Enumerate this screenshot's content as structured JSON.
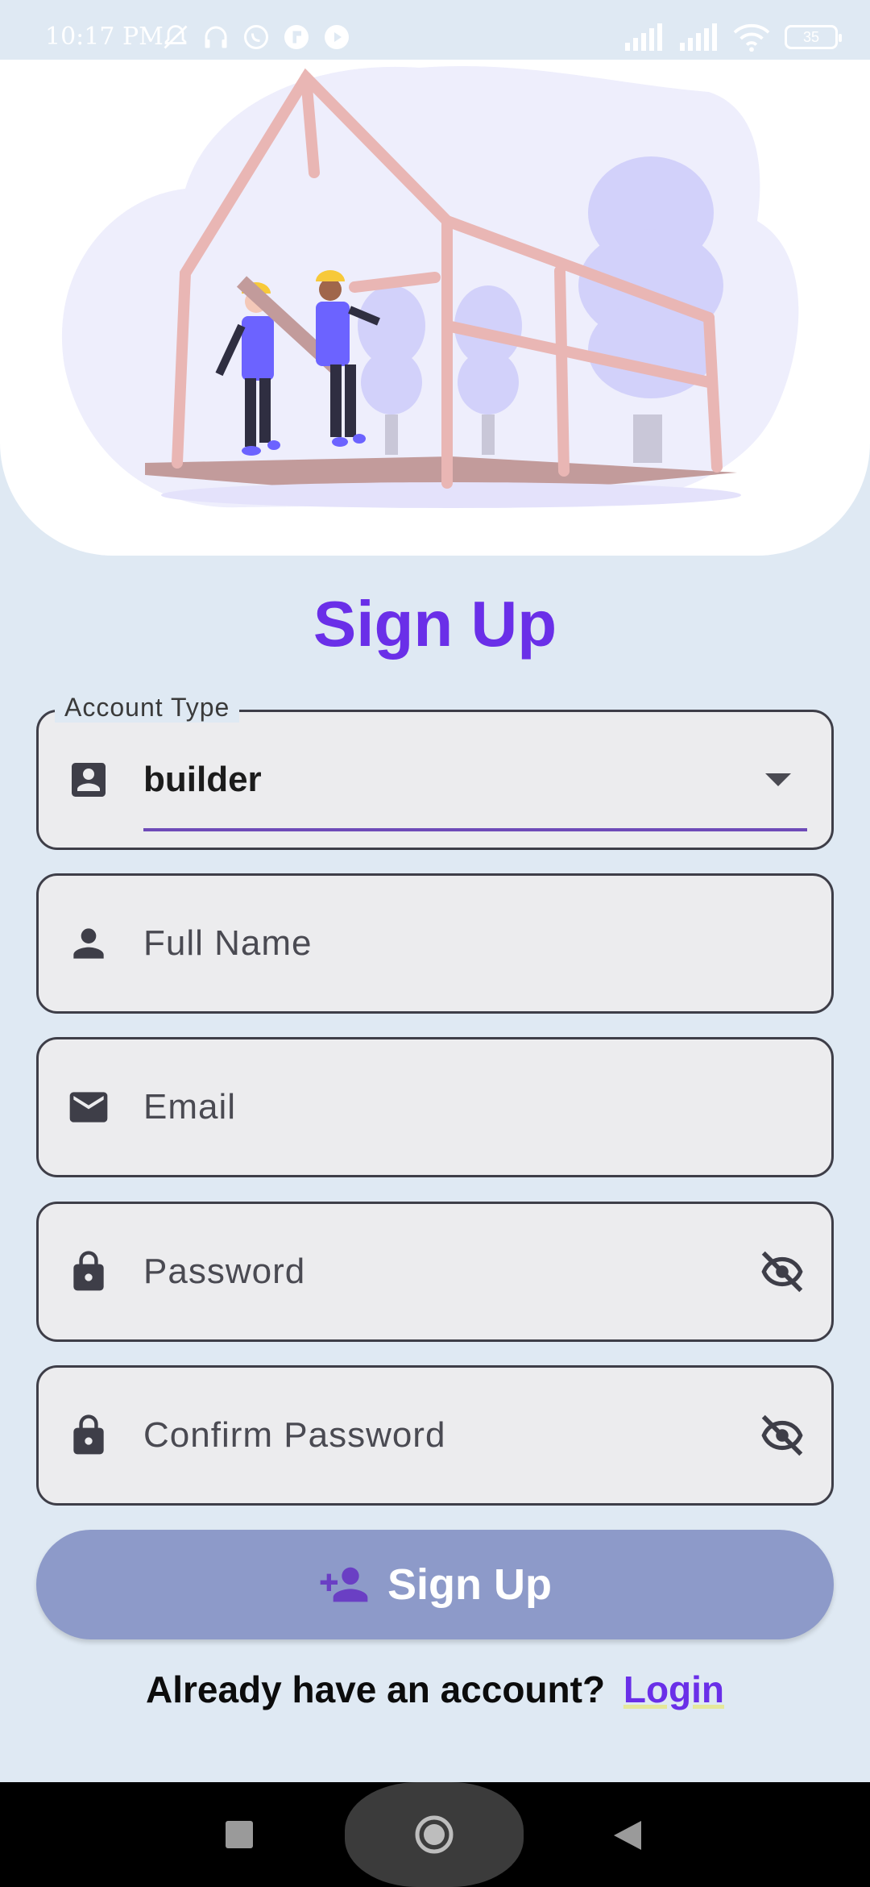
{
  "status_bar": {
    "time": "10:17 PM",
    "battery": "35",
    "left_icons": [
      "mute-bell-icon",
      "headphones-icon",
      "whatsapp-icon",
      "app-icon",
      "play-icon"
    ],
    "right_icons": [
      "signal-icon",
      "signal-icon",
      "wifi-icon",
      "battery-icon"
    ]
  },
  "page": {
    "title": "Sign Up"
  },
  "form": {
    "account_type": {
      "label": "Account Type",
      "value": "builder",
      "icon": "account-box-icon"
    },
    "full_name": {
      "placeholder": "Full Name",
      "icon": "person-icon"
    },
    "email": {
      "placeholder": "Email",
      "icon": "mail-icon"
    },
    "password": {
      "placeholder": "Password",
      "icon": "lock-icon",
      "toggle_icon": "visibility-off-icon"
    },
    "confirm_password": {
      "placeholder": "Confirm Password",
      "icon": "lock-icon",
      "toggle_icon": "visibility-off-icon"
    }
  },
  "actions": {
    "signup_label": "Sign Up",
    "signup_icon": "person-add-icon"
  },
  "footer": {
    "prompt": "Already have an account?",
    "login_label": "Login"
  },
  "colors": {
    "accent": "#6a2fe8",
    "button_bg": "#8d9ac9",
    "page_bg": "#dfe9f3",
    "field_bg": "#ececee"
  }
}
